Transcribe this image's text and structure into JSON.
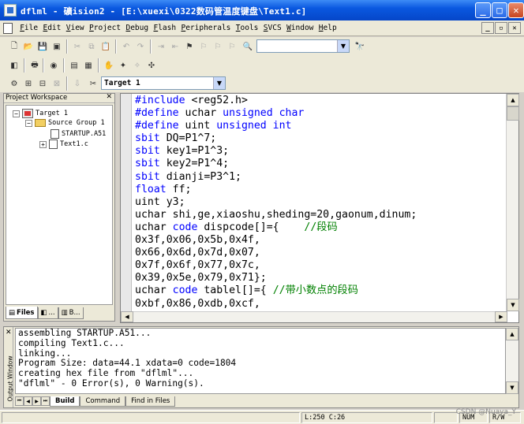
{
  "window": {
    "title": "dflml  - 礦ision2 - [E:\\xuexi\\0322数码管温度键盘\\Text1.c]",
    "controls": [
      "_",
      "□",
      "✕"
    ]
  },
  "menu": {
    "items": [
      "File",
      "Edit",
      "View",
      "Project",
      "Debug",
      "Flash",
      "Peripherals",
      "Tools",
      "SVCS",
      "Window",
      "Help"
    ],
    "mdi_controls": [
      "_",
      "▫",
      "✕"
    ]
  },
  "toolbar": {
    "find_combo_value": "",
    "target_combo_value": "Target 1"
  },
  "project_workspace": {
    "title": "Project Workspace",
    "tree": [
      {
        "label": "Target 1",
        "expander": "−"
      },
      {
        "label": "Source Group 1",
        "expander": "−"
      },
      {
        "label": "STARTUP.A51",
        "expander": ""
      },
      {
        "label": "Text1.c",
        "expander": "+"
      }
    ],
    "tabs": [
      "Files",
      "...",
      "B..."
    ]
  },
  "editor": {
    "lines": [
      [
        {
          "t": "#include",
          "c": "kw"
        },
        {
          "t": " <reg52.h>"
        }
      ],
      [
        {
          "t": "#define",
          "c": "kw"
        },
        {
          "t": " uchar "
        },
        {
          "t": "unsigned char",
          "c": "kw"
        }
      ],
      [
        {
          "t": "#define",
          "c": "kw"
        },
        {
          "t": " uint "
        },
        {
          "t": "unsigned int",
          "c": "kw"
        }
      ],
      [
        {
          "t": "sbit",
          "c": "kw"
        },
        {
          "t": " DQ=P1^7;"
        }
      ],
      [
        {
          "t": "sbit",
          "c": "kw"
        },
        {
          "t": " key1=P1^3;"
        }
      ],
      [
        {
          "t": "sbit",
          "c": "kw"
        },
        {
          "t": " key2=P1^4;"
        }
      ],
      [
        {
          "t": "sbit",
          "c": "kw"
        },
        {
          "t": " dianji=P3^1;"
        }
      ],
      [
        {
          "t": "float",
          "c": "kw"
        },
        {
          "t": " ff;"
        }
      ],
      [
        {
          "t": "uint y3;"
        }
      ],
      [
        {
          "t": "uchar shi,ge,xiaoshu,sheding=20,gaonum,dinum;"
        }
      ],
      [
        {
          "t": "uchar "
        },
        {
          "t": "code",
          "c": "kw"
        },
        {
          "t": " dispcode[]={    "
        },
        {
          "t": "//段码",
          "c": "cm"
        }
      ],
      [
        {
          "t": "0x3f,0x06,0x5b,0x4f,"
        }
      ],
      [
        {
          "t": "0x66,0x6d,0x7d,0x07,"
        }
      ],
      [
        {
          "t": "0x7f,0x6f,0x77,0x7c,"
        }
      ],
      [
        {
          "t": "0x39,0x5e,0x79,0x71};"
        }
      ],
      [
        {
          "t": "uchar "
        },
        {
          "t": "code",
          "c": "kw"
        },
        {
          "t": " tablel[]={ "
        },
        {
          "t": "//带小数点的段码",
          "c": "cm"
        }
      ],
      [
        {
          "t": "0xbf,0x86,0xdb,0xcf,"
        }
      ]
    ]
  },
  "output": {
    "title": "Output Window",
    "lines": [
      "assembling STARTUP.A51...",
      "compiling Text1.c...",
      "linking...",
      "Program Size: data=44.1 xdata=0 code=1804",
      "creating hex file from \"dflml\"...",
      "\"dflml\" - 0 Error(s), 0 Warning(s)."
    ],
    "tabs": [
      "Build",
      "Command",
      "Find in Files"
    ]
  },
  "status": {
    "position": "L:250 C:26",
    "num": "NUM",
    "rw": "R/W"
  },
  "watermark": "CSDN @Nuaya_Y",
  "colors": {
    "keyword": "#0000ff",
    "comment": "#008000",
    "titlebar": "#0a58e0"
  }
}
